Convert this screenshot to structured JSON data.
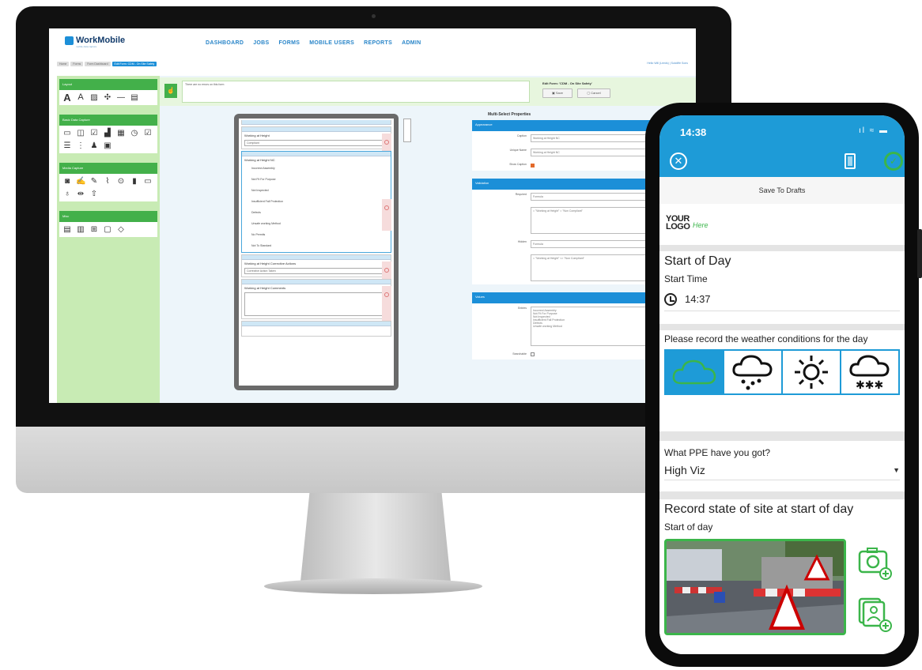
{
  "desktop": {
    "brand": {
      "name": "WorkMobile",
      "tagline": "mobile data capture"
    },
    "nav": [
      "DASHBOARD",
      "JOBS",
      "FORMS",
      "MOBILE USERS",
      "REPORTS",
      "ADMIN"
    ],
    "breadcrumbs": [
      "Home",
      "Forms",
      "Form Dashboard",
      "Edit Form: CDM - On Site Safety"
    ],
    "user_info": "Hello Will (Leeds) | Sutcliffe Sons",
    "palette": {
      "groups": [
        {
          "title": "Layout",
          "icons": [
            "text-large-icon",
            "text-medium-icon",
            "image-icon",
            "divider-icon",
            "line-icon",
            "page-icon"
          ]
        },
        {
          "title": "Basic Data Capture",
          "icons": [
            "text-field-icon",
            "number-field-icon",
            "checkbox-icon",
            "chart-icon",
            "calendar-icon",
            "time-icon",
            "multi-check-icon",
            "list-icon",
            "tree-icon",
            "person-icon",
            "keyboard-icon"
          ]
        },
        {
          "title": "Media Capture",
          "icons": [
            "camera-icon",
            "signature-icon",
            "draw-icon",
            "attachment-icon",
            "location-icon",
            "barcode-icon",
            "video-icon",
            "audio-icon",
            "distance-icon",
            "upload-icon"
          ]
        },
        {
          "title": "Misc",
          "icons": [
            "form-icon",
            "sub-form-icon",
            "lookup-icon",
            "panel-icon",
            "tag-icon"
          ]
        }
      ]
    },
    "note": {
      "text": "There are no errors on this form"
    },
    "edit_form_title": "Edit Form: 'CDM - On Site Safety'",
    "save_label": "Save",
    "cancel_label": "Cancel",
    "tablet": {
      "fields": [
        {
          "label": "Working at Height",
          "value": "Compliant",
          "type": "dropdown"
        },
        {
          "label": "Working at Height NC",
          "type": "multiselect",
          "options": [
            "Incorrect Assembly",
            "Not Fit For Purpose",
            "Not Inspected",
            "Insufficient Fall Protection",
            "Defects",
            "Unsafe working Method",
            "No Permits",
            "Not To Standard"
          ]
        },
        {
          "label": "Working at Height Corrective Actions",
          "value": "Corrective Action Taken",
          "type": "dropdown"
        },
        {
          "label": "Working at Height Comments",
          "type": "textarea"
        }
      ]
    },
    "properties": {
      "title": "Multi-Select Properties",
      "appearance_header": "Appearance",
      "caption_label": "Caption",
      "caption_value": "Working at Height NC",
      "unique_name_label": "Unique Name",
      "unique_name_value": "Working at Height NC",
      "show_caption_label": "Show Caption",
      "validation_header": "Validation",
      "required_label": "Required",
      "required_value": "Formula",
      "required_formula": "= \"Working at Height\" = \"Non Compliant\"",
      "hidden_label": "Hidden",
      "hidden_value": "Formula",
      "hidden_formula": "= \"Working at Height\" <> \"Non Compliant\"",
      "values_header": "Values",
      "entries_label": "Entries",
      "entries": [
        "Incorrect Assembly",
        "Not Fit For Purpose",
        "Not Inspected",
        "Insufficient Fall Protection",
        "Defects",
        "Unsafe working Method"
      ],
      "searchable_label": "Searchable"
    }
  },
  "phone": {
    "time": "14:38",
    "status_icons": "ıl ≈ ▬",
    "save_to_drafts": "Save To Drafts",
    "logo_line1": "YOUR",
    "logo_line2": "LOGO",
    "logo_here": "Here",
    "section1_title": "Start of Day",
    "start_time_label": "Start Time",
    "start_time_value": "14:37",
    "weather_question": "Please record the weather conditions for the day",
    "weather_options": [
      "cloud-icon",
      "rain-icon",
      "sun-icon",
      "snow-icon"
    ],
    "ppe_question": "What PPE have you got?",
    "ppe_value": "High Viz",
    "section3_title": "Record state of site at start of day",
    "photo_label": "Start of day",
    "accent": "#1e9bd7",
    "green": "#3bb54a"
  }
}
